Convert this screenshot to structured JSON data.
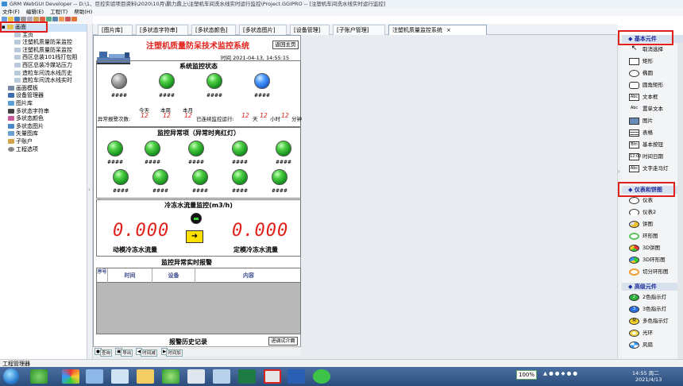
{
  "window": {
    "title": "GRM WebGUI Developer -- D:\\1、巨控实验项目资料\\2020\\10月\\鹏力鼎上\\注塑机车间洗水线实时运行监控\\Project.GGIPRO -- [注塑机车间洗水线实时运行监控]"
  },
  "menubar": {
    "items": [
      "文件(F)",
      "编辑(E)",
      "工程(T)",
      "帮助(H)"
    ]
  },
  "tree": {
    "root": "画面",
    "items": [
      {
        "label": "主页",
        "level": 2
      },
      {
        "label": "注塑机质量防呆监控",
        "level": 2
      },
      {
        "label": "注塑机质量防呆监控",
        "level": 2
      },
      {
        "label": "西区总装101线打包阻",
        "level": 2
      },
      {
        "label": "西区总装冷媒站压力",
        "level": 2
      },
      {
        "label": "造粒车间流水线历史",
        "level": 2
      },
      {
        "label": "造粒车间流水线实时",
        "level": 2
      },
      {
        "label": "画面模板",
        "level": 1
      },
      {
        "label": "设备管理器",
        "level": 1
      },
      {
        "label": "图片库",
        "level": 1
      },
      {
        "label": "多状态字符串",
        "level": 1
      },
      {
        "label": "多状态颜色",
        "level": 1
      },
      {
        "label": "多状态图片",
        "level": 1
      },
      {
        "label": "矢量图库",
        "level": 1
      },
      {
        "label": "子账户",
        "level": 1
      },
      {
        "label": "工程选项",
        "level": 1
      }
    ]
  },
  "tabs": [
    {
      "label": "[图片库]",
      "active": false
    },
    {
      "label": "[多状态字符串]",
      "active": false
    },
    {
      "label": "[多状态颜色]",
      "active": false
    },
    {
      "label": "[多状态图片]",
      "active": false
    },
    {
      "label": "[设备管理]",
      "active": false
    },
    {
      "label": "[子账户管理]",
      "active": false
    },
    {
      "label": "注塑机质量监控系统",
      "active": true
    }
  ],
  "screen": {
    "title": "注塑机质量防呆技术监控系统",
    "back_button": "返回主页",
    "time_label": "时间",
    "time_value": "2021-04-13, 14:55:15",
    "status_panel": {
      "title": "系统监控状态",
      "lamp_labels": [
        "####",
        "####",
        "####",
        "####"
      ],
      "col_today": "今天",
      "col_week": "本周",
      "col_month": "本月",
      "alarm_count_label": "异常报警次数:",
      "today_value": "12",
      "week_value": "12",
      "month_value": "12",
      "running_label": "已连续监控运行:",
      "days_value": "12",
      "days_unit": "天",
      "hours_value": "12",
      "hours_unit": "小时",
      "minutes_value": "12",
      "minutes_unit": "分钟"
    },
    "alarm_panel": {
      "title": "监控异常项（异常时亮红灯）",
      "row1_labels": [
        "####",
        "####",
        "####",
        "####",
        "####"
      ],
      "row2_labels": [
        "####",
        "####",
        "####",
        "####",
        "####"
      ]
    },
    "flow_panel": {
      "title": "冷冻水流量监控(m3/h)",
      "left_value": "0.000",
      "right_value": "0.000",
      "left_label": "动模冷冻水流量",
      "right_label": "定模冷冻水流量"
    },
    "realtime_alarm": {
      "title": "监控异常实时报警",
      "columns": [
        "序号",
        "时间",
        "设备",
        "内容"
      ]
    },
    "history": {
      "title": "报警历史记录",
      "enter_button": "进调试介面"
    },
    "bottom_buttons": [
      "查询",
      "导出",
      "时间减",
      "时间加"
    ]
  },
  "right_panel": {
    "sections": [
      {
        "title": "基本元件",
        "items": [
          {
            "label": "取消选择",
            "icon": "cursor-icon"
          },
          {
            "label": "矩形",
            "icon": "rectangle-icon"
          },
          {
            "label": "椭圆",
            "icon": "ellipse-icon"
          },
          {
            "label": "圆角矩形",
            "icon": "rounded-rect-icon"
          },
          {
            "label": "文本框",
            "icon": "textbox-icon"
          },
          {
            "label": "置单文本",
            "icon": "text-icon"
          },
          {
            "label": "图片",
            "icon": "picture-icon"
          },
          {
            "label": "表格",
            "icon": "table-icon"
          },
          {
            "label": "基本按钮",
            "icon": "button-icon"
          },
          {
            "label": "时间日期",
            "icon": "datetime-icon"
          },
          {
            "label": "文字走马灯",
            "icon": "marquee-icon"
          }
        ]
      },
      {
        "title": "仪表和饼图",
        "items": [
          {
            "label": "仪表",
            "icon": "gauge-icon"
          },
          {
            "label": "仪表2",
            "icon": "gauge2-icon"
          },
          {
            "label": "饼图",
            "icon": "pie-icon"
          },
          {
            "label": "环形图",
            "icon": "ring-icon"
          },
          {
            "label": "3D饼图",
            "icon": "pie3d-icon"
          },
          {
            "label": "3D环形图",
            "icon": "ring3d-icon"
          },
          {
            "label": "切分环形图",
            "icon": "split-ring-icon"
          }
        ]
      },
      {
        "title": "高级元件",
        "items": [
          {
            "label": "2色指示灯",
            "icon": "lamp2-icon"
          },
          {
            "label": "3色指示灯",
            "icon": "lamp3-icon"
          },
          {
            "label": "多色指示灯",
            "icon": "lampm-icon"
          },
          {
            "label": "光环",
            "icon": "halo-icon"
          },
          {
            "label": "风扇",
            "icon": "fan-icon"
          }
        ]
      }
    ]
  },
  "statusbar": {
    "label": "工程管理器"
  },
  "taskbar": {
    "zoom": "100%",
    "clock_time": "14:55 周二",
    "clock_date": "2021/4/13"
  },
  "colors": {
    "accent_red": "#e0211b",
    "lamp_green": "#1aa82a",
    "lamp_blue": "#2a6fe0",
    "highlight_box": "#e0211b"
  }
}
